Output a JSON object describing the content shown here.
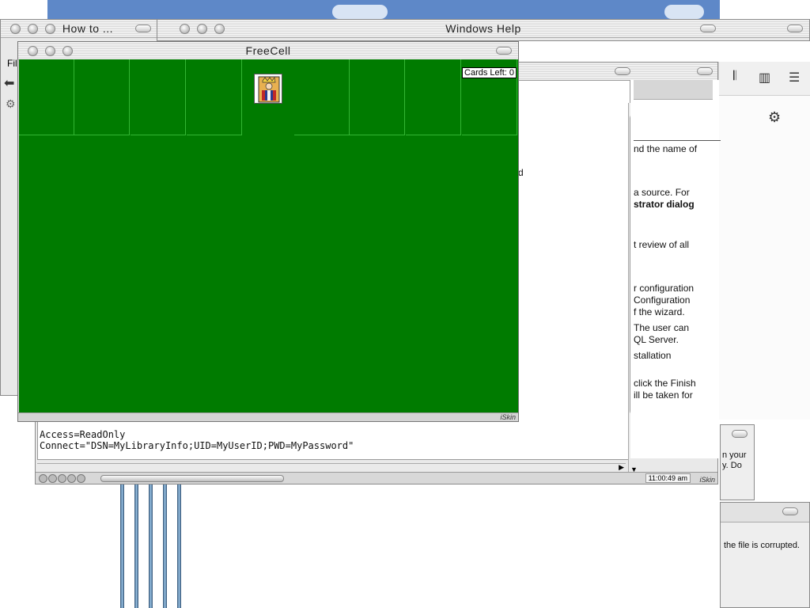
{
  "windows": {
    "howto_title": "How to ...",
    "windows_help_title": "Windows Help",
    "freecell_title": "FreeCell",
    "howto_menu": "File"
  },
  "freecell": {
    "cards_left": "Cards Left: 0",
    "skin_label": "iSkin",
    "felt_color": "#007b00",
    "king_icon": "king-card-icon"
  },
  "help": {
    "right_lines": [
      "nd the name of",
      "d",
      "a source. For",
      "strator dialog",
      "t review of all",
      "r configuration",
      "Configuration",
      "f the wizard.",
      "The user can",
      "QL Server.",
      "stallation",
      "click the Finish",
      "ill be taken for"
    ],
    "code_lines": [
      "Access=ReadOnly",
      "Connect=\"DSN=MyLibraryInfo;UID=MyUserID;PWD=MyPassword\""
    ],
    "time": "11:00:49 am",
    "skin_label": "iSkin"
  },
  "sidebar": {
    "library_icon": "library-icon",
    "sidebar_icon": "sidebar-toggle-icon",
    "menu_icon": "menu-icon",
    "gear_icon": "gear-icon"
  },
  "dialogs": {
    "dlg1_lines": [
      "n your",
      "y. Do"
    ],
    "dlg2_text": "the file is corrupted."
  }
}
